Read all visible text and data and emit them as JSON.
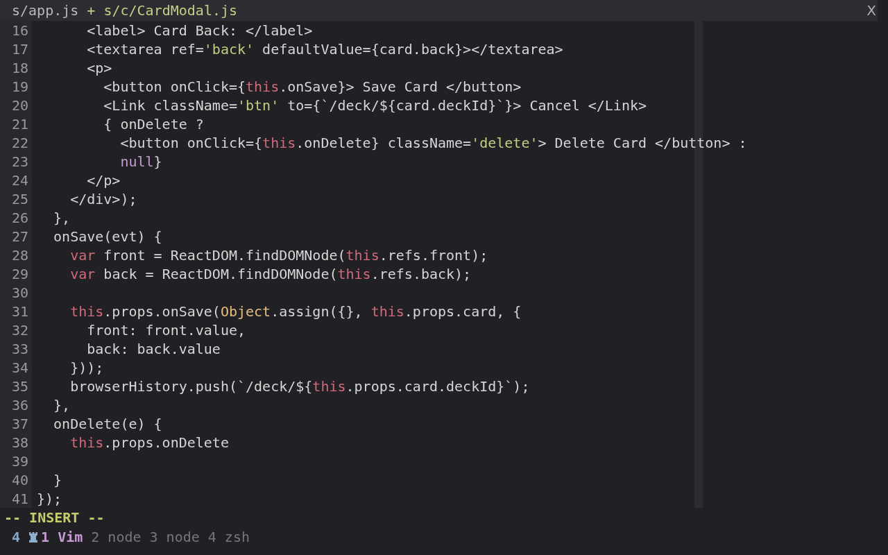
{
  "tabs": [
    {
      "label": "s/app.js",
      "selected": false
    },
    {
      "label": "+ s/c/CardModal.js",
      "selected": true
    }
  ],
  "close": "X",
  "lines": [
    {
      "number": "16",
      "tokens": [
        {
          "kind": "text",
          "text": "      <label> Card Back: </label>"
        }
      ]
    },
    {
      "number": "17",
      "tokens": [
        {
          "kind": "text",
          "text": "      <textarea ref="
        },
        {
          "kind": "string",
          "text": "'back'"
        },
        {
          "kind": "text",
          "text": " defaultValue={card.back}></textarea>"
        }
      ]
    },
    {
      "number": "18",
      "tokens": [
        {
          "kind": "text",
          "text": "      <p>"
        }
      ]
    },
    {
      "number": "19",
      "tokens": [
        {
          "kind": "text",
          "text": "        <button onClick={"
        },
        {
          "kind": "keyword",
          "text": "this"
        },
        {
          "kind": "text",
          "text": ".onSave}> Save Card </button>"
        }
      ]
    },
    {
      "number": "20",
      "tokens": [
        {
          "kind": "text",
          "text": "        <Link className="
        },
        {
          "kind": "string",
          "text": "'btn'"
        },
        {
          "kind": "text",
          "text": " to={`/deck/${card.deckId}`}> Cancel </Link>"
        }
      ]
    },
    {
      "number": "21",
      "tokens": [
        {
          "kind": "text",
          "text": "        { onDelete ?"
        }
      ]
    },
    {
      "number": "22",
      "tokens": [
        {
          "kind": "text",
          "text": "          <button onClick={"
        },
        {
          "kind": "keyword",
          "text": "this"
        },
        {
          "kind": "text",
          "text": ".onDelete} className="
        },
        {
          "kind": "string",
          "text": "'delete'"
        },
        {
          "kind": "text",
          "text": "> Delete Card </button> :"
        }
      ]
    },
    {
      "number": "23",
      "tokens": [
        {
          "kind": "constant",
          "text": "          null"
        },
        {
          "kind": "text",
          "text": "}"
        }
      ]
    },
    {
      "number": "24",
      "tokens": [
        {
          "kind": "text",
          "text": "      </p>"
        }
      ]
    },
    {
      "number": "25",
      "tokens": [
        {
          "kind": "text",
          "text": "    </div>);"
        }
      ]
    },
    {
      "number": "26",
      "tokens": [
        {
          "kind": "text",
          "text": "  },"
        }
      ]
    },
    {
      "number": "27",
      "tokens": [
        {
          "kind": "text",
          "text": "  onSave(evt) {"
        }
      ]
    },
    {
      "number": "28",
      "tokens": [
        {
          "kind": "keyword",
          "text": "    var"
        },
        {
          "kind": "text",
          "text": " front = ReactDOM.findDOMNode("
        },
        {
          "kind": "keyword",
          "text": "this"
        },
        {
          "kind": "text",
          "text": ".refs.front);"
        }
      ]
    },
    {
      "number": "29",
      "tokens": [
        {
          "kind": "keyword",
          "text": "    var"
        },
        {
          "kind": "text",
          "text": " back = ReactDOM.findDOMNode("
        },
        {
          "kind": "keyword",
          "text": "this"
        },
        {
          "kind": "text",
          "text": ".refs.back);"
        }
      ]
    },
    {
      "number": "30"
    },
    {
      "number": "31",
      "tokens": [
        {
          "kind": "keyword",
          "text": "    this"
        },
        {
          "kind": "text",
          "text": ".props.onSave("
        },
        {
          "kind": "builtin",
          "text": "Object"
        },
        {
          "kind": "text",
          "text": ".assign({}, "
        },
        {
          "kind": "keyword",
          "text": "this"
        },
        {
          "kind": "text",
          "text": ".props.card, {"
        }
      ]
    },
    {
      "number": "32",
      "tokens": [
        {
          "kind": "text",
          "text": "      front: front.value,"
        }
      ]
    },
    {
      "number": "33",
      "tokens": [
        {
          "kind": "text",
          "text": "      back: back.value"
        }
      ]
    },
    {
      "number": "34",
      "tokens": [
        {
          "kind": "text",
          "text": "    }));"
        }
      ]
    },
    {
      "number": "35",
      "tokens": [
        {
          "kind": "text",
          "text": "    browserHistory.push(`/deck/${"
        },
        {
          "kind": "keyword",
          "text": "this"
        },
        {
          "kind": "text",
          "text": ".props.card.deckId}`);"
        }
      ]
    },
    {
      "number": "36",
      "tokens": [
        {
          "kind": "text",
          "text": "  },"
        }
      ]
    },
    {
      "number": "37",
      "tokens": [
        {
          "kind": "text",
          "text": "  onDelete(e) {"
        }
      ]
    },
    {
      "number": "38",
      "tokens": [
        {
          "kind": "keyword",
          "text": "    this"
        },
        {
          "kind": "text",
          "text": ".props.onDelete"
        }
      ]
    },
    {
      "number": "39"
    },
    {
      "number": "40",
      "tokens": [
        {
          "kind": "text",
          "text": "  }"
        }
      ]
    },
    {
      "number": "41",
      "tokens": [
        {
          "kind": "text",
          "text": "});"
        }
      ]
    }
  ],
  "mode": "-- INSERT --",
  "session": "4",
  "windows": [
    {
      "label": "1 Vim",
      "selected": true
    },
    {
      "label": "2 node",
      "selected": false
    },
    {
      "label": "3 node",
      "selected": false
    },
    {
      "label": "4 zsh",
      "selected": false
    }
  ]
}
